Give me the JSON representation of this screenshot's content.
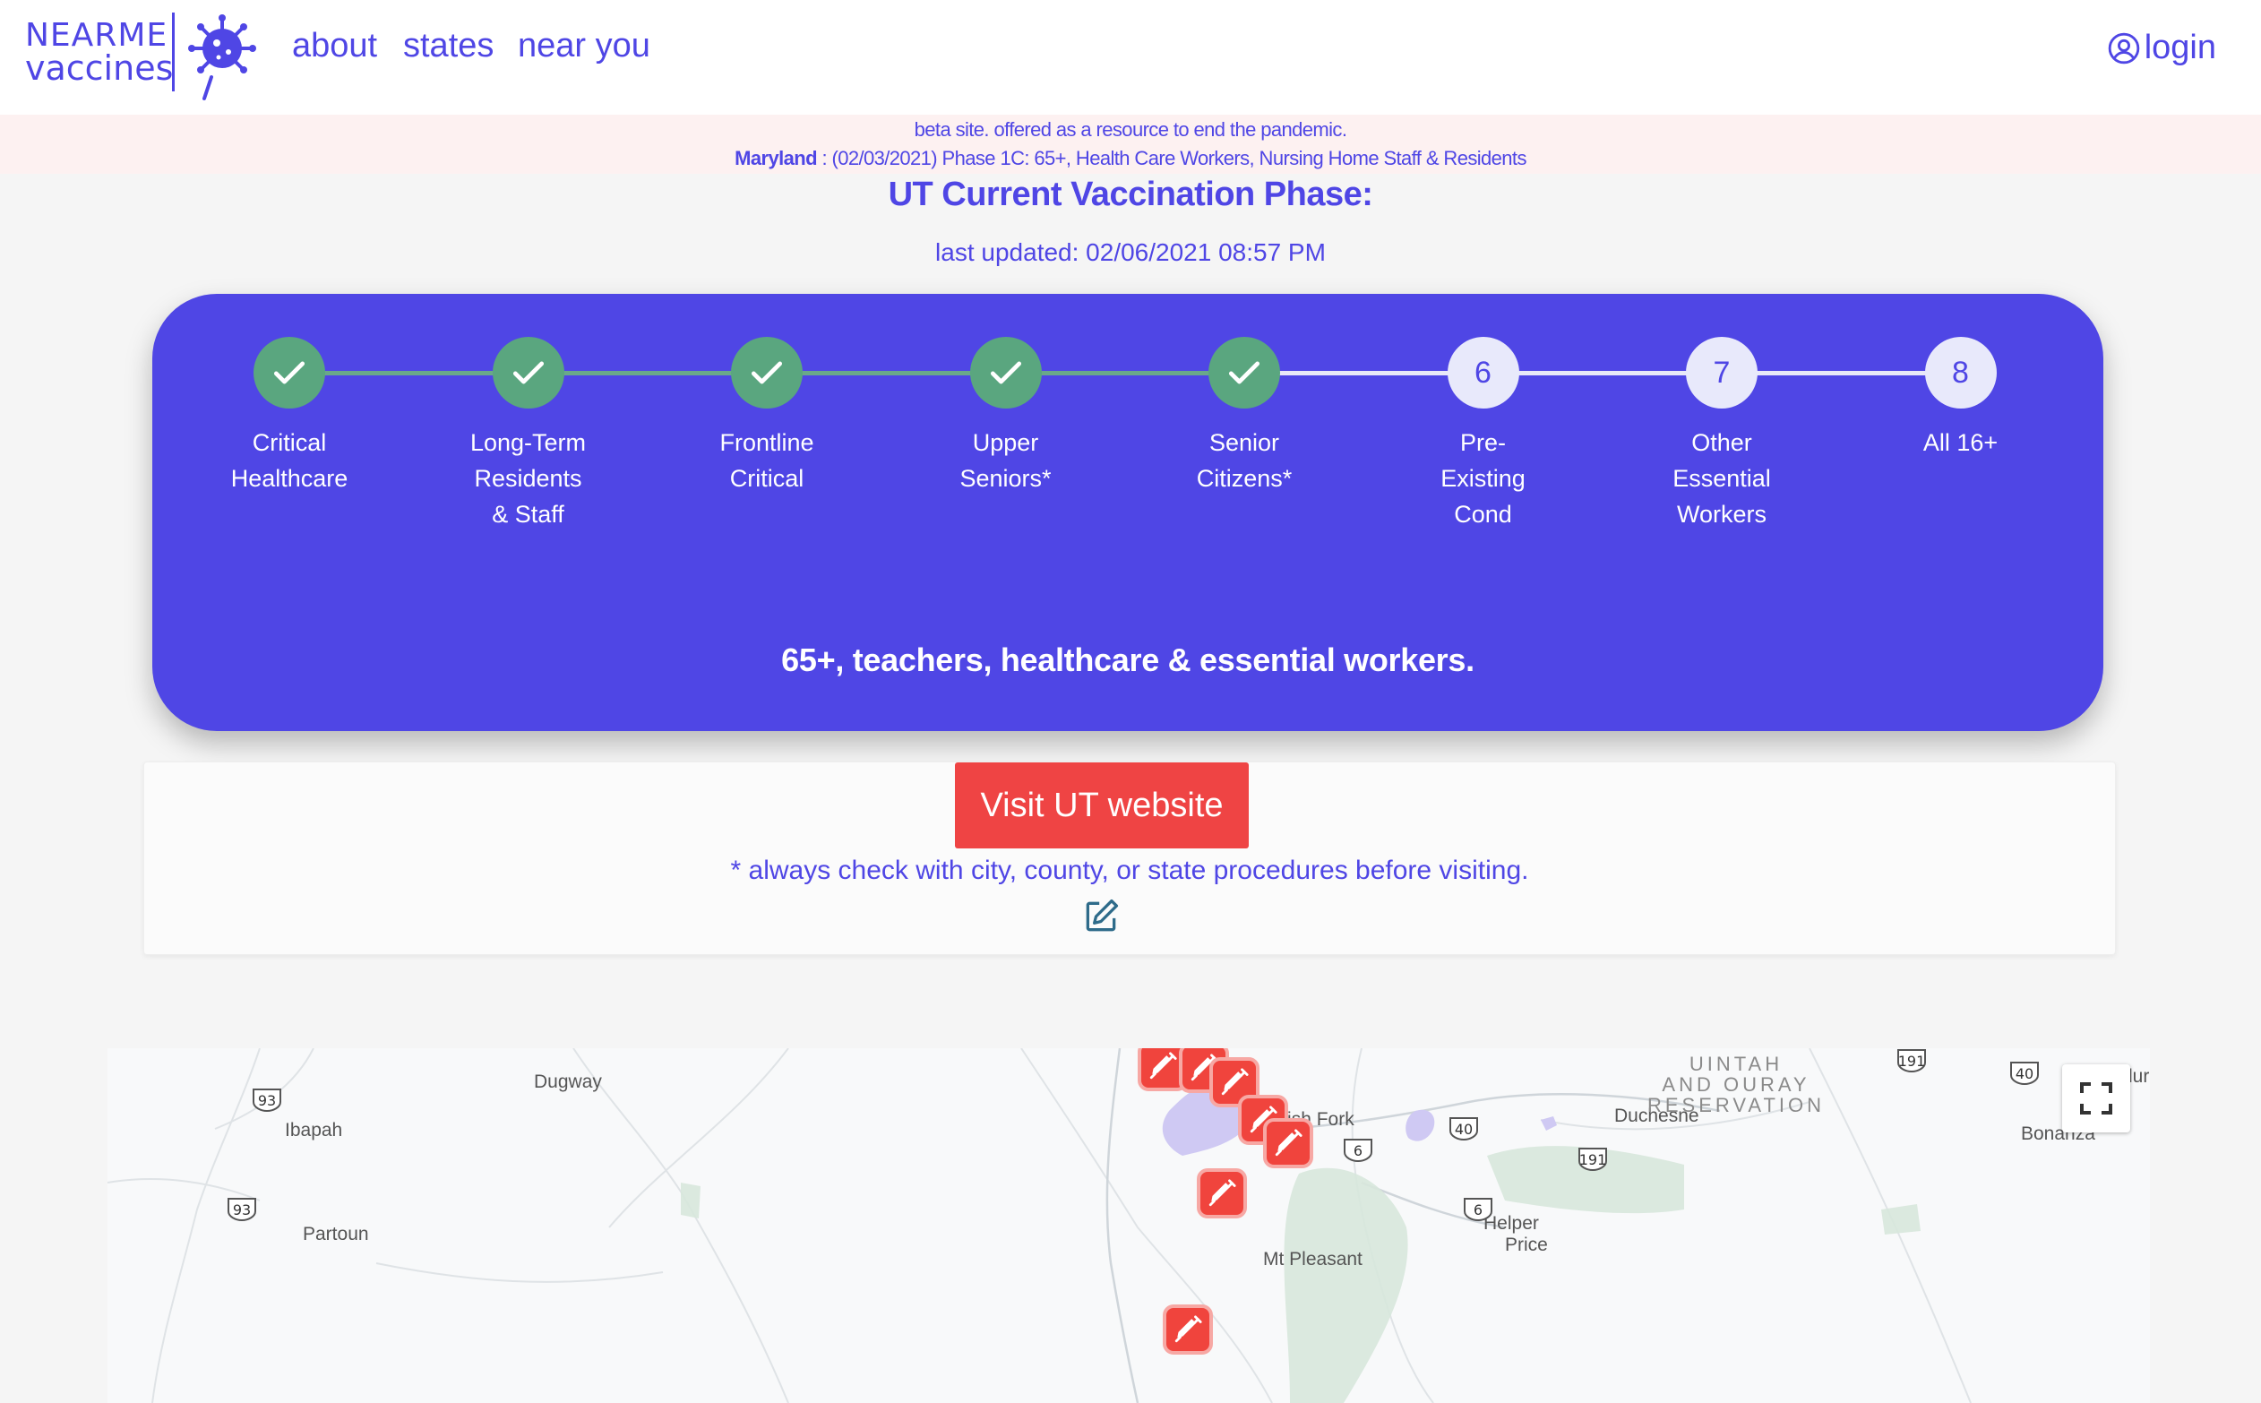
{
  "header": {
    "logo_line1": "NEARME",
    "logo_line2": "vaccines",
    "nav": [
      "about",
      "states",
      "near you"
    ],
    "login": "login"
  },
  "banner": {
    "line1": "beta site. offered as a resource to end the pandemic.",
    "state": "Maryland",
    "line2_rest": " : (02/03/2021) Phase 1C: 65+, Health Care Workers, Nursing Home Staff & Residents"
  },
  "phase": {
    "title": "UT Current Vaccination Phase:",
    "updated": "last updated: 02/06/2021 08:57 PM",
    "completed_steps": 5,
    "steps": [
      {
        "number": "1",
        "label": [
          "Critical",
          "Healthcare"
        ],
        "done": true
      },
      {
        "number": "2",
        "label": [
          "Long-Term",
          "Residents",
          "& Staff"
        ],
        "done": true
      },
      {
        "number": "3",
        "label": [
          "Frontline",
          "Critical"
        ],
        "done": true
      },
      {
        "number": "4",
        "label": [
          "Upper",
          "Seniors*"
        ],
        "done": true
      },
      {
        "number": "5",
        "label": [
          "Senior",
          "Citizens*"
        ],
        "done": true
      },
      {
        "number": "6",
        "label": [
          "Pre-",
          "Existing",
          "Cond"
        ],
        "done": false
      },
      {
        "number": "7",
        "label": [
          "Other",
          "Essential",
          "Workers"
        ],
        "done": false
      },
      {
        "number": "8",
        "label": [
          "All 16+"
        ],
        "done": false
      }
    ],
    "summary": "65+, teachers, healthcare & essential workers."
  },
  "info": {
    "visit_label": "Visit UT website",
    "note": "* always check with city, county, or state procedures before visiting."
  },
  "map": {
    "places": [
      "Dugway",
      "Ibapah",
      "Partoun",
      "Spanish Fork",
      "Duchesne",
      "Bonanza",
      "Helper",
      "Price",
      "Mt Pleasant",
      "lur"
    ],
    "reservation": [
      "UINTAH",
      "AND OURAY",
      "RESERVATION"
    ],
    "highways": [
      "93",
      "93",
      "6",
      "6",
      "191",
      "191",
      "40",
      "40"
    ],
    "marker_icon": "syringe-icon"
  },
  "colors": {
    "primary": "#4f46e5",
    "done": "#5aa67f",
    "accent_red": "#ef4444",
    "banner_bg": "#fdf1f1"
  }
}
